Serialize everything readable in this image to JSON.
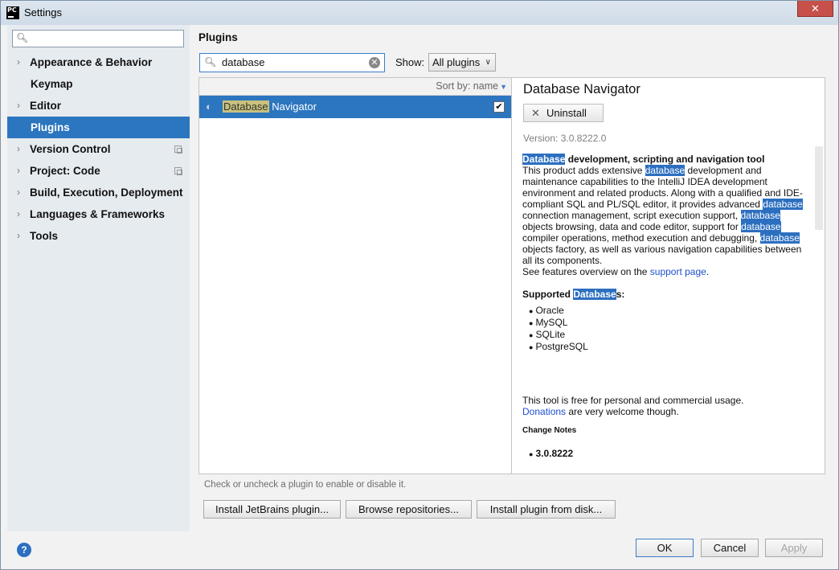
{
  "window": {
    "title": "Settings",
    "close_label": "✕"
  },
  "sidebar": {
    "search_placeholder": "",
    "items": [
      {
        "label": "Appearance & Behavior",
        "expandable": true
      },
      {
        "label": "Keymap",
        "expandable": false
      },
      {
        "label": "Editor",
        "expandable": true
      },
      {
        "label": "Plugins",
        "expandable": false,
        "selected": true
      },
      {
        "label": "Version Control",
        "expandable": true,
        "project_icon": true
      },
      {
        "label": "Project: Code",
        "expandable": true,
        "project_icon": true
      },
      {
        "label": "Build, Execution, Deployment",
        "expandable": true
      },
      {
        "label": "Languages & Frameworks",
        "expandable": true
      },
      {
        "label": "Tools",
        "expandable": true
      }
    ],
    "help_label": "?"
  },
  "plugins": {
    "title": "Plugins",
    "search_value": "database",
    "show_label": "Show:",
    "show_value": "All plugins",
    "sort_label": "Sort by: name",
    "list": [
      {
        "name_highlight": "Database",
        "name_rest": " Navigator",
        "checked": true
      }
    ]
  },
  "detail": {
    "name": "Database Navigator",
    "uninstall_label": "Uninstall",
    "version": "Version: 3.0.8222.0",
    "headline_highlight": "Database",
    "headline_rest": " development, scripting and navigation tool",
    "p1_a": "This product adds extensive ",
    "p1_b": "database",
    "p1_c": " development and maintenance capabilities to the IntelliJ IDEA development environment and related products. Along with a qualified and IDE-compliant SQL and PL/SQL editor, it provides advanced ",
    "p1_d": "database",
    "p1_e": " connection management, script execution support, ",
    "p1_f": "database",
    "p1_g": " objects browsing, data and code editor, support for ",
    "p1_h": "database",
    "p1_i": " compiler operations, method execution and debugging, ",
    "p1_j": "database",
    "p1_k": " objects factory, as well as various navigation capabilities between all its components.",
    "features_prefix": "See features overview on the ",
    "features_link": "support page",
    "features_suffix": ".",
    "supported_a": "Supported ",
    "supported_b": "Database",
    "supported_c": "s:",
    "databases": [
      "Oracle",
      "MySQL",
      "SQLite",
      "PostgreSQL"
    ],
    "free_text": "This tool is free for personal and commercial usage.",
    "donations_link": "Donations",
    "donations_rest": " are very welcome though.",
    "change_notes_title": "Change Notes",
    "change_version": "3.0.8222"
  },
  "footer": {
    "hint": "Check or uncheck a plugin to enable or disable it.",
    "install_jetbrains": "Install JetBrains plugin...",
    "browse_repos": "Browse repositories...",
    "install_disk": "Install plugin from disk...",
    "ok": "OK",
    "cancel": "Cancel",
    "apply": "Apply"
  }
}
